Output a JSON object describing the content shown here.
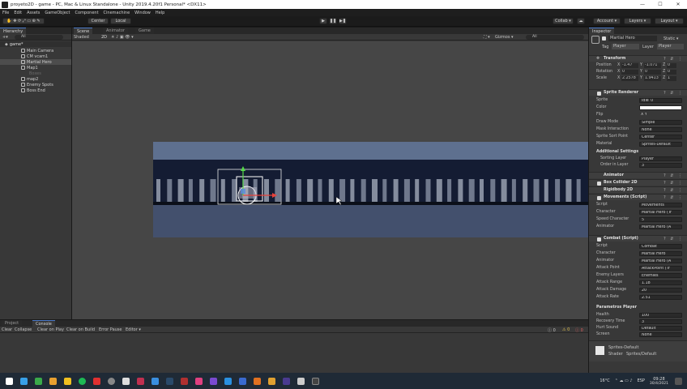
{
  "window": {
    "title": "proyeto2D - game - PC, Mac & Linux Standalone - Unity 2019.4.20f1 Personal* <DX11>",
    "controls": [
      "—",
      "☐",
      "✕"
    ]
  },
  "menu": [
    "File",
    "Edit",
    "Assets",
    "GameObject",
    "Component",
    "Cinemachine",
    "Window",
    "Help"
  ],
  "toolbar": {
    "center": "Center",
    "local": "Local",
    "collab": "Collab ▾",
    "account": "Account ▾",
    "layers": "Layers ▾",
    "layout": "Layout ▾"
  },
  "hierarchy": {
    "tab": "Hierarchy",
    "search_all": "All",
    "scene": "game*",
    "items": [
      {
        "label": "Main Camera"
      },
      {
        "label": "CM vcam1"
      },
      {
        "label": "Martial Hero",
        "selected": true
      },
      {
        "label": "Map1"
      },
      {
        "label": "Boxes"
      },
      {
        "label": "map2"
      },
      {
        "label": "Enemy Spots"
      },
      {
        "label": "Boss End"
      }
    ]
  },
  "scene": {
    "tabs": [
      "Scene",
      "Animator",
      "Game"
    ],
    "shading": "Shaded",
    "mode2d": "2D",
    "gizmos": "Gizmos ▾",
    "search_all": "All"
  },
  "bottom": {
    "tabs": [
      "Project",
      "Console"
    ],
    "buttons": [
      "Clear",
      "Collapse",
      "Clear on Play",
      "Clear on Build",
      "Error Pause",
      "Editor ▾"
    ],
    "counts": [
      "0",
      "0",
      "0"
    ]
  },
  "inspector": {
    "tab": "Inspector",
    "object_name": "Martial Hero",
    "static": "Static ▾",
    "tag_label": "Tag",
    "tag": "Player",
    "layer_label": "Layer",
    "layer": "Player",
    "transform": {
      "title": "Transform",
      "rows": [
        {
          "label": "Position",
          "x": "-1.47",
          "y": "-1.071",
          "z": "0"
        },
        {
          "label": "Rotation",
          "x": "0",
          "y": "0",
          "z": "0"
        },
        {
          "label": "Scale",
          "x": "2.2578",
          "y": "1.9413",
          "z": "1"
        }
      ]
    },
    "sprite_renderer": {
      "title": "Sprite Renderer",
      "rows": [
        {
          "label": "Sprite",
          "value": "Idle_0"
        },
        {
          "label": "Color",
          "value": ""
        },
        {
          "label": "Flip",
          "value": "X  Y"
        },
        {
          "label": "Draw Mode",
          "value": "Simple"
        },
        {
          "label": "Mask Interaction",
          "value": "None"
        },
        {
          "label": "Sprite Sort Point",
          "value": "Center"
        },
        {
          "label": "Material",
          "value": "Sprites-Default"
        }
      ],
      "additional": "Additional Settings",
      "sorting_layer_label": "Sorting Layer",
      "sorting_layer": "Player",
      "order_label": "Order in Layer",
      "order": "3"
    },
    "components": [
      "Animator",
      "Box Collider 2D",
      "Rigidbody 2D",
      "Movements (Script)"
    ],
    "movements": [
      {
        "label": "Script",
        "value": "Movements"
      },
      {
        "label": "Character",
        "value": "Martial Hero (Tr"
      },
      {
        "label": "Speed Character",
        "value": "5"
      },
      {
        "label": "Animator",
        "value": "Martial Hero (A"
      }
    ],
    "combat": {
      "title": "Combat (Script)",
      "rows": [
        {
          "label": "Script",
          "value": "Combat"
        },
        {
          "label": "Character",
          "value": "Martial Hero"
        },
        {
          "label": "Animator",
          "value": "Martial Hero (A"
        },
        {
          "label": "Attack Point",
          "value": "AttackPoint (Tr"
        },
        {
          "label": "Enemy Layers",
          "value": "Enemies"
        },
        {
          "label": "Attack Range",
          "value": "1.18"
        },
        {
          "label": "Attack Damage",
          "value": "20"
        },
        {
          "label": "Attack Rate",
          "value": "2.51"
        }
      ]
    },
    "params": {
      "title": "Parametros Player",
      "rows": [
        {
          "label": "Health",
          "value": "100"
        },
        {
          "label": "Recovery Time",
          "value": "3"
        },
        {
          "label": "Hurt Sound",
          "value": "Default"
        },
        {
          "label": "Screen",
          "value": "None"
        }
      ]
    },
    "material_name": "Sprites-Default",
    "shader_label": "Shader",
    "shader": "Sprites/Default"
  },
  "taskbar": {
    "time": "09:28",
    "date": "30/4/2021",
    "weather": "16°C",
    "lang": "ESP"
  },
  "colors": {
    "accent": "#4a78c8",
    "gizmo_green": "#56d94a",
    "gizmo_red": "#e8413a",
    "sky": "#5e708f",
    "floor": "#43506d"
  }
}
